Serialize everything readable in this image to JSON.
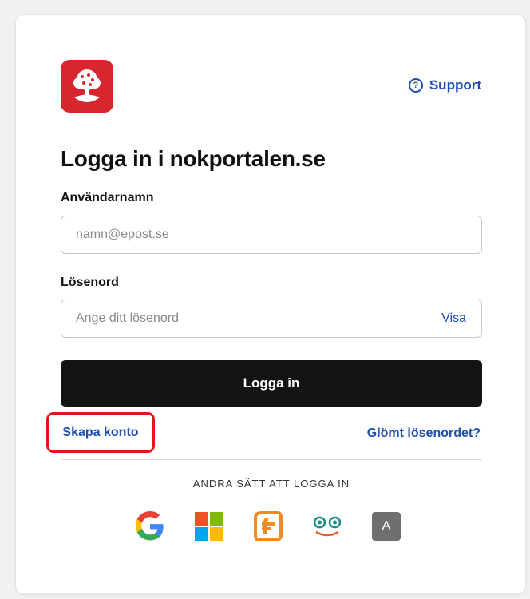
{
  "header": {
    "support_label": "Support",
    "support_icon": "?"
  },
  "form": {
    "title": "Logga in i nokportalen.se",
    "username_label": "Användarnamn",
    "username_placeholder": "namn@epost.se",
    "username_value": "",
    "password_label": "Lösenord",
    "password_placeholder": "Ange ditt lösenord",
    "password_value": "",
    "show_password_label": "Visa",
    "login_button": "Logga in"
  },
  "links": {
    "create_account": "Skapa konto",
    "forgot_password": "Glömt lösenordet?"
  },
  "other_logins": {
    "heading": "ANDRA SÄTT ATT LOGGA IN",
    "providers": [
      "google-icon",
      "microsoft-icon",
      "feide-icon",
      "eye-logo-icon",
      "a-icon"
    ],
    "a_letter": "A"
  },
  "colors": {
    "brand_red": "#d8262e",
    "link_blue": "#1e4fb0",
    "button_black": "#141414",
    "highlight_red": "#e0161c"
  }
}
